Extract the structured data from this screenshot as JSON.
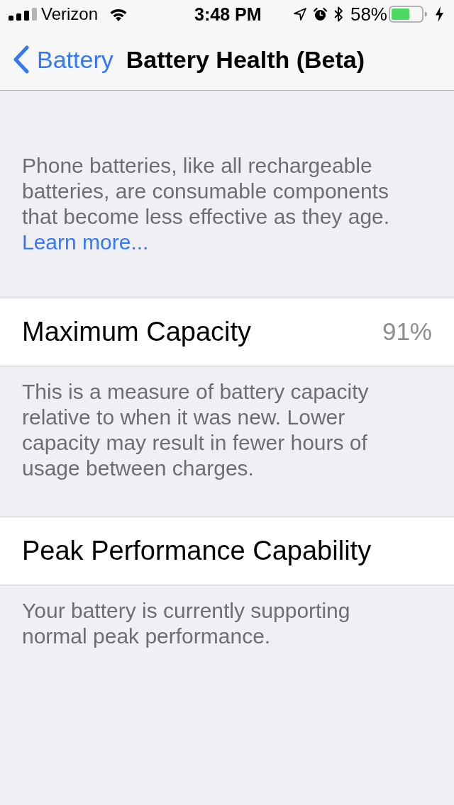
{
  "status_bar": {
    "carrier": "Verizon",
    "time": "3:48 PM",
    "battery_percent": "58%"
  },
  "nav_bar": {
    "back_label": "Battery",
    "title": "Battery Health (Beta)"
  },
  "intro": {
    "text": "Phone batteries, like all rechargeable batteries, are consumable components that become less effective as they age.",
    "link": "Learn more..."
  },
  "sections": [
    {
      "label": "Maximum Capacity",
      "value": "91%",
      "footer": "This is a measure of battery capacity relative to when it was new. Lower capacity may result in fewer hours of usage between charges."
    },
    {
      "label": "Peak Performance Capability",
      "footer": "Your battery is currently supporting normal peak performance."
    }
  ]
}
